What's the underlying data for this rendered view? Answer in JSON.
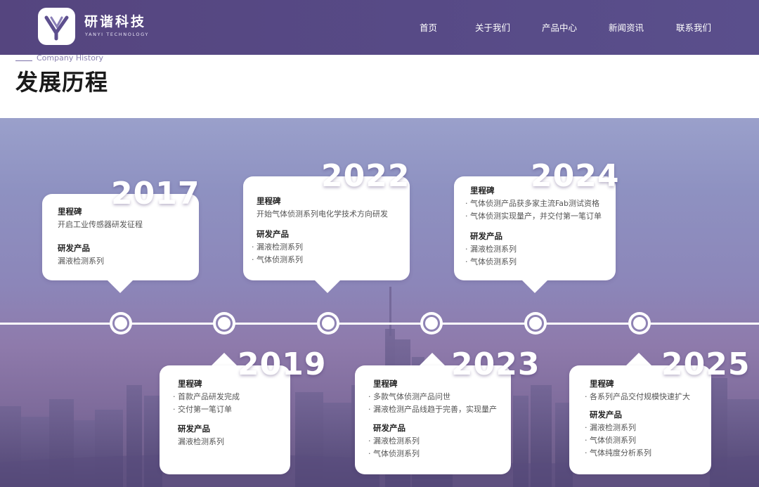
{
  "header": {
    "brand_cn": "研谐科技",
    "brand_en": "YANYI TECHNOLOGY",
    "nav": [
      "首页",
      "关于我们",
      "产品中心",
      "新闻资讯",
      "联系我们"
    ]
  },
  "section": {
    "subtitle_en": "Company History",
    "title": "发展历程"
  },
  "labels": {
    "milestone": "里程碑",
    "products": "研发产品"
  },
  "timeline": [
    {
      "year": "2017",
      "milestones": [
        "开启工业传感器研发征程"
      ],
      "products": [
        "漏液检测系列"
      ]
    },
    {
      "year": "2019",
      "milestones": [
        "· 首款产品研发完成",
        "· 交付第一笔订单"
      ],
      "products": [
        "漏液检测系列"
      ]
    },
    {
      "year": "2022",
      "milestones": [
        "开始气体侦测系列电化学技术方向研发"
      ],
      "products": [
        "· 漏液检测系列",
        "· 气体侦测系列"
      ]
    },
    {
      "year": "2023",
      "milestones": [
        "· 多款气体侦测产品问世",
        "· 漏液检测产品线趋于完善，实现量产"
      ],
      "products": [
        "· 漏液检测系列",
        "· 气体侦测系列"
      ]
    },
    {
      "year": "2024",
      "milestones": [
        "· 气体侦测产品获多家主流Fab测试资格",
        "· 气体侦测实现量产，并交付第一笔订单"
      ],
      "products": [
        "· 漏液检测系列",
        "· 气体侦测系列"
      ]
    },
    {
      "year": "2025",
      "milestones": [
        "· 各系列产品交付规模快速扩大"
      ],
      "products": [
        "· 漏液检测系列",
        "· 气体侦测系列",
        "· 气体纯度分析系列"
      ]
    }
  ],
  "colors": {
    "header_bg": "#564882",
    "accent": "#8f83b4",
    "title": "#1a1a1a"
  }
}
